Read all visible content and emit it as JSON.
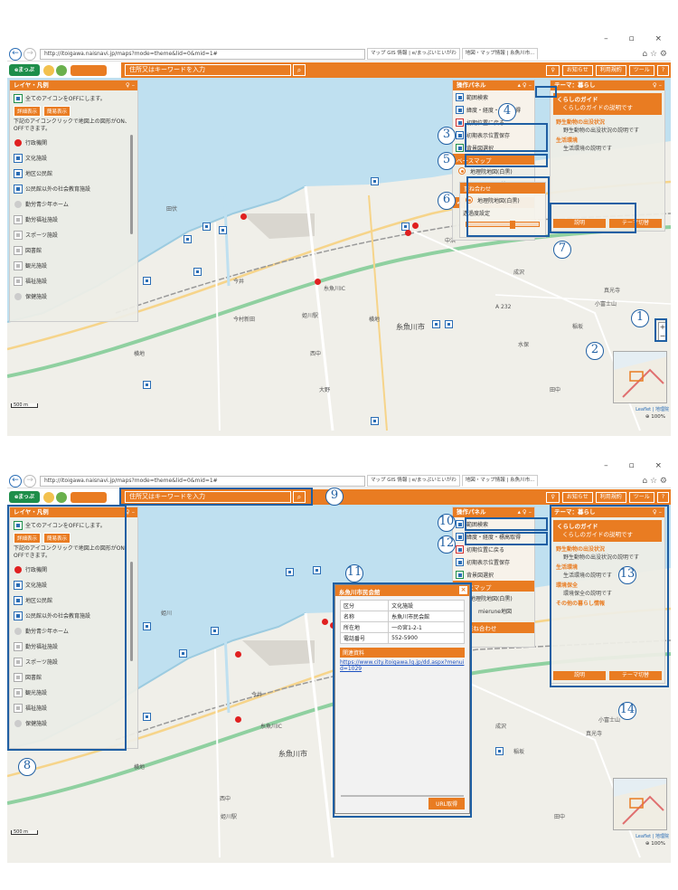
{
  "browser": {
    "address": "http://itoigawa.naisnavi.jp/maps?mode=theme&lid=0&mid=1#",
    "tabs": [
      "マップ GIS 情報 | e/まっぷいといがわ",
      "地図・マップ情報 | 糸魚川市...",
      "マップ GIS 情報 | e/まっぷいといがわ"
    ],
    "window_controls": "–  ▫  ×"
  },
  "app": {
    "search_placeholder": "住所又はキーワードを入力",
    "search_button": "⌕",
    "info_button": "お知らせ",
    "terms_button": "利用規約",
    "tools_button": "ツール",
    "help_button": "?"
  },
  "layer_panel": {
    "title": "レイヤ・凡例",
    "ctrl": "♀ –",
    "toggle_all": "全てのアイコンをOFFにします。",
    "detail_button": "詳細表示",
    "simple_button": "簡易表示",
    "note": "下記のアイコンクリックで地図上の図形がON、OFFできます。",
    "items": [
      "行政機関",
      "文化施設",
      "地区公民館",
      "公民館以外の社会教育施設",
      "勤労青少年ホーム",
      "勤労福祉施設",
      "スポーツ施設",
      "図書館",
      "観光施設",
      "福祉施設",
      "保健施設"
    ]
  },
  "ops_panel": {
    "title": "操作パネル",
    "ctrl": "▴ ♀ –",
    "items": [
      "範囲検索",
      "緯度・経度・標高取得",
      "初期位置に戻る",
      "初期表示位置保存",
      "背景図選択"
    ],
    "basemap_title": "ベースマップ",
    "basemaps": [
      "地理院地図(白黒)",
      "mierune地図"
    ],
    "overlay": "重ね合わせ"
  },
  "overlay_panel": {
    "title": "重ね合わせ",
    "item": "地理院地図(白黒)",
    "opacity": "透過度設定",
    "opacity_value": 0.6
  },
  "theme_panel": {
    "title": "テーマ：暮らし",
    "ctrl": "♀ –",
    "guide_title": "くらしのガイド",
    "guide_desc": "くらしのガイドの説明です",
    "sections": [
      {
        "t": "野生動物の出没状況",
        "d": "野生動物の出没状況の説明です"
      },
      {
        "t": "生活環境",
        "d": "生活環境の説明です"
      },
      {
        "t": "環境保全",
        "d": "環境保全の説明です"
      }
    ],
    "other": "その他の暮らし情報",
    "explain_button": "説明",
    "theme_button": "テーマ切替"
  },
  "map": {
    "labels": [
      "糸魚川市",
      "今井",
      "頭山",
      "大野",
      "西中",
      "横地",
      "姫川駅",
      "糸魚川IC",
      "田伏",
      "中浜",
      "寺地",
      "成沢",
      "真光寺",
      "小富士山",
      "稲坂",
      "水保",
      "田中",
      "頭山",
      "今村新田",
      "A 232",
      "姫川"
    ],
    "scale": "500 m",
    "attribution": "Leaflet | 地理院",
    "zoom_level": "⊕ 100%",
    "zoom_in": "+",
    "zoom_out": "−"
  },
  "popup": {
    "title": "糸魚川市民会館",
    "close": "×",
    "rows": [
      [
        "区分",
        "文化施設"
      ],
      [
        "名称",
        "糸魚川市民会館"
      ],
      [
        "所在地",
        "一の宮1-2-1"
      ],
      [
        "電話番号",
        "552-5900"
      ]
    ],
    "related": "関連資料",
    "link": "https://www.city.itoigawa.lg.jp/dd.aspx?menuid=1029",
    "url_button": "URL取得"
  },
  "callouts_top": [
    "4",
    "3",
    "5",
    "6",
    "7",
    "1",
    "2"
  ],
  "callouts_bottom": [
    "9",
    "10",
    "12",
    "11",
    "8",
    "13",
    "14"
  ]
}
